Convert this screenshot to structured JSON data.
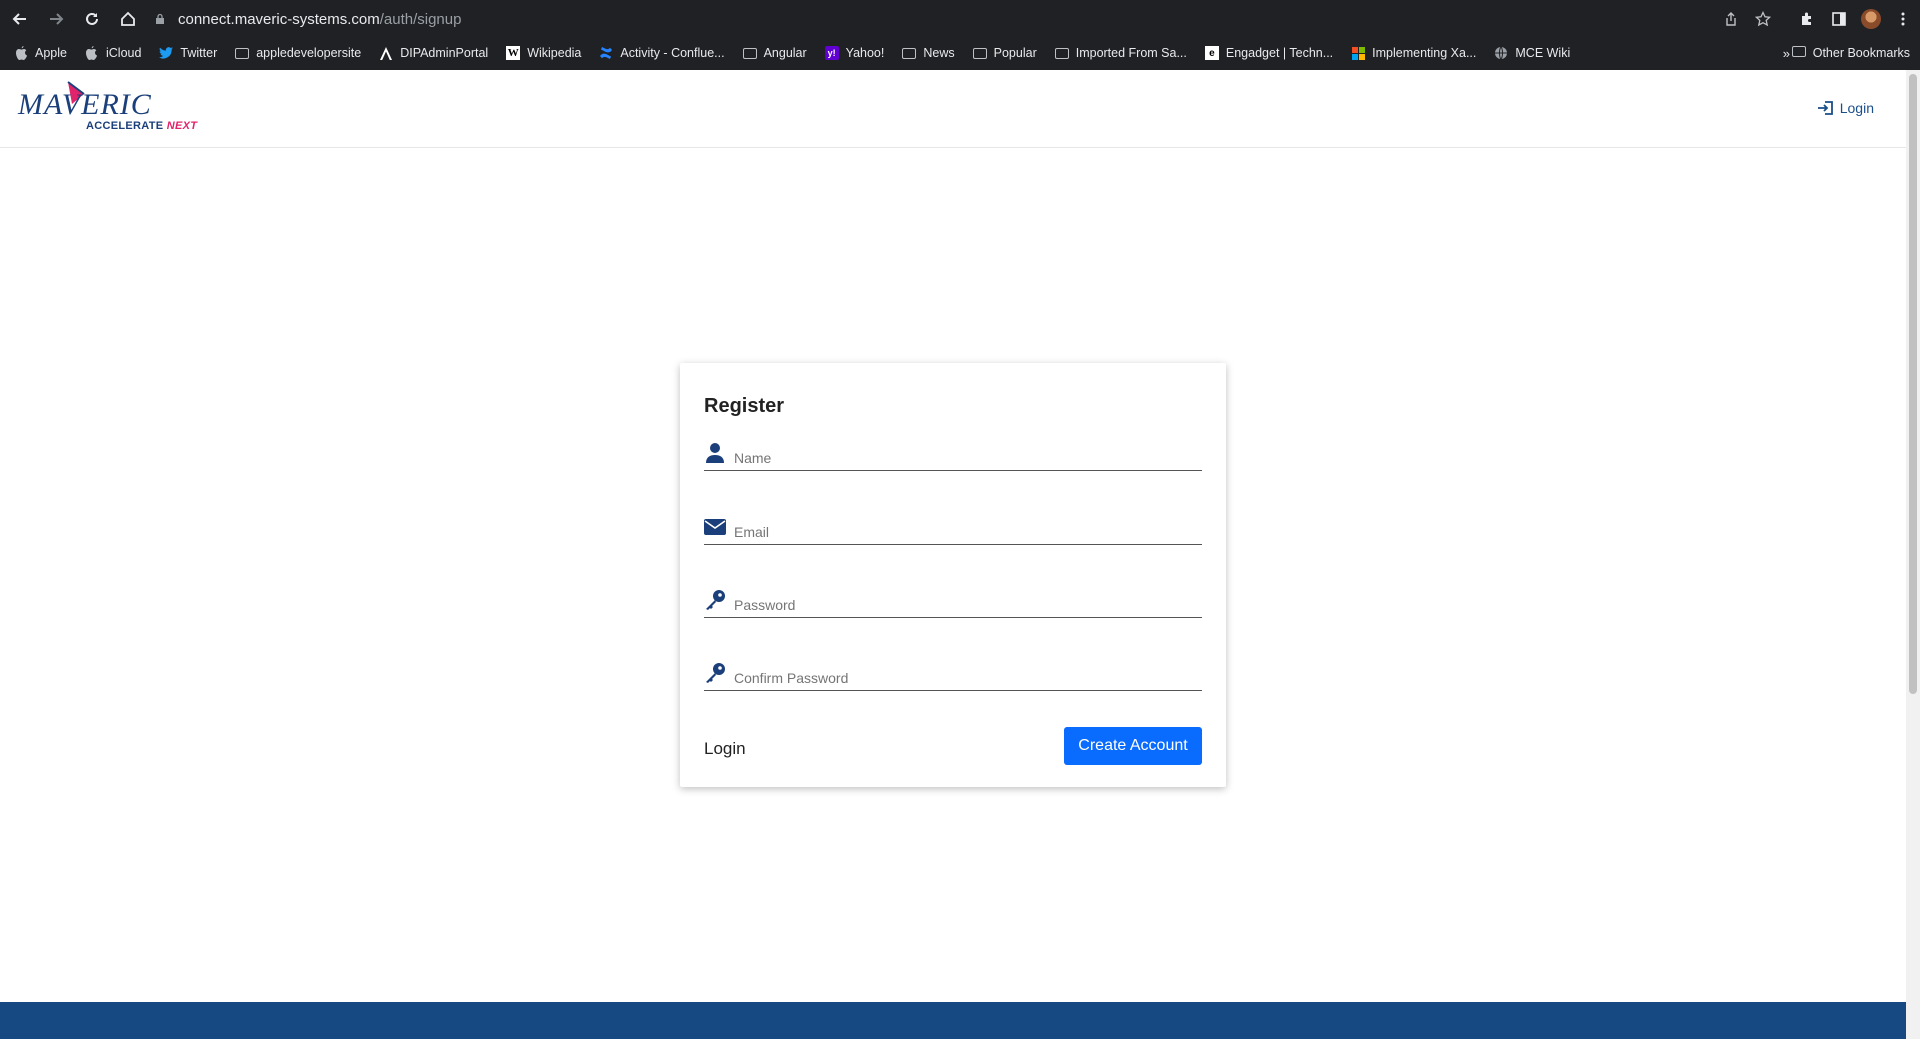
{
  "browser": {
    "url_host": "connect.maveric-systems.com",
    "url_path": "/auth/signup",
    "bookmarks": [
      {
        "label": "Apple",
        "icon": "apple-icon"
      },
      {
        "label": "iCloud",
        "icon": "apple-icon"
      },
      {
        "label": "Twitter",
        "icon": "twitter-icon"
      },
      {
        "label": "appledevelopersite",
        "icon": "folder-icon"
      },
      {
        "label": "DIPAdminPortal",
        "icon": "angular-icon"
      },
      {
        "label": "Wikipedia",
        "icon": "wikipedia-icon"
      },
      {
        "label": "Activity - Conflue...",
        "icon": "confluence-icon"
      },
      {
        "label": "Angular",
        "icon": "folder-icon"
      },
      {
        "label": "Yahoo!",
        "icon": "yahoo-icon"
      },
      {
        "label": "News",
        "icon": "folder-icon"
      },
      {
        "label": "Popular",
        "icon": "folder-icon"
      },
      {
        "label": "Imported From Sa...",
        "icon": "folder-icon"
      },
      {
        "label": "Engadget | Techn...",
        "icon": "engadget-icon"
      },
      {
        "label": "Implementing Xa...",
        "icon": "microsoft-icon"
      },
      {
        "label": "MCE Wiki",
        "icon": "globe-icon"
      }
    ],
    "more_label": "»",
    "other_bookmarks": "Other Bookmarks"
  },
  "header": {
    "logo_word": "MAVERIC",
    "logo_accelerate": "ACCELERATE",
    "logo_next": "NEXT",
    "login_label": "Login"
  },
  "register": {
    "title": "Register",
    "name_placeholder": "Name",
    "email_placeholder": "Email",
    "password_placeholder": "Password",
    "confirm_placeholder": "Confirm Password",
    "login_link": "Login",
    "create_button": "Create Account"
  },
  "colors": {
    "brand_blue": "#164882",
    "button_blue": "#0a6bff",
    "accent_pink": "#e0246b"
  }
}
